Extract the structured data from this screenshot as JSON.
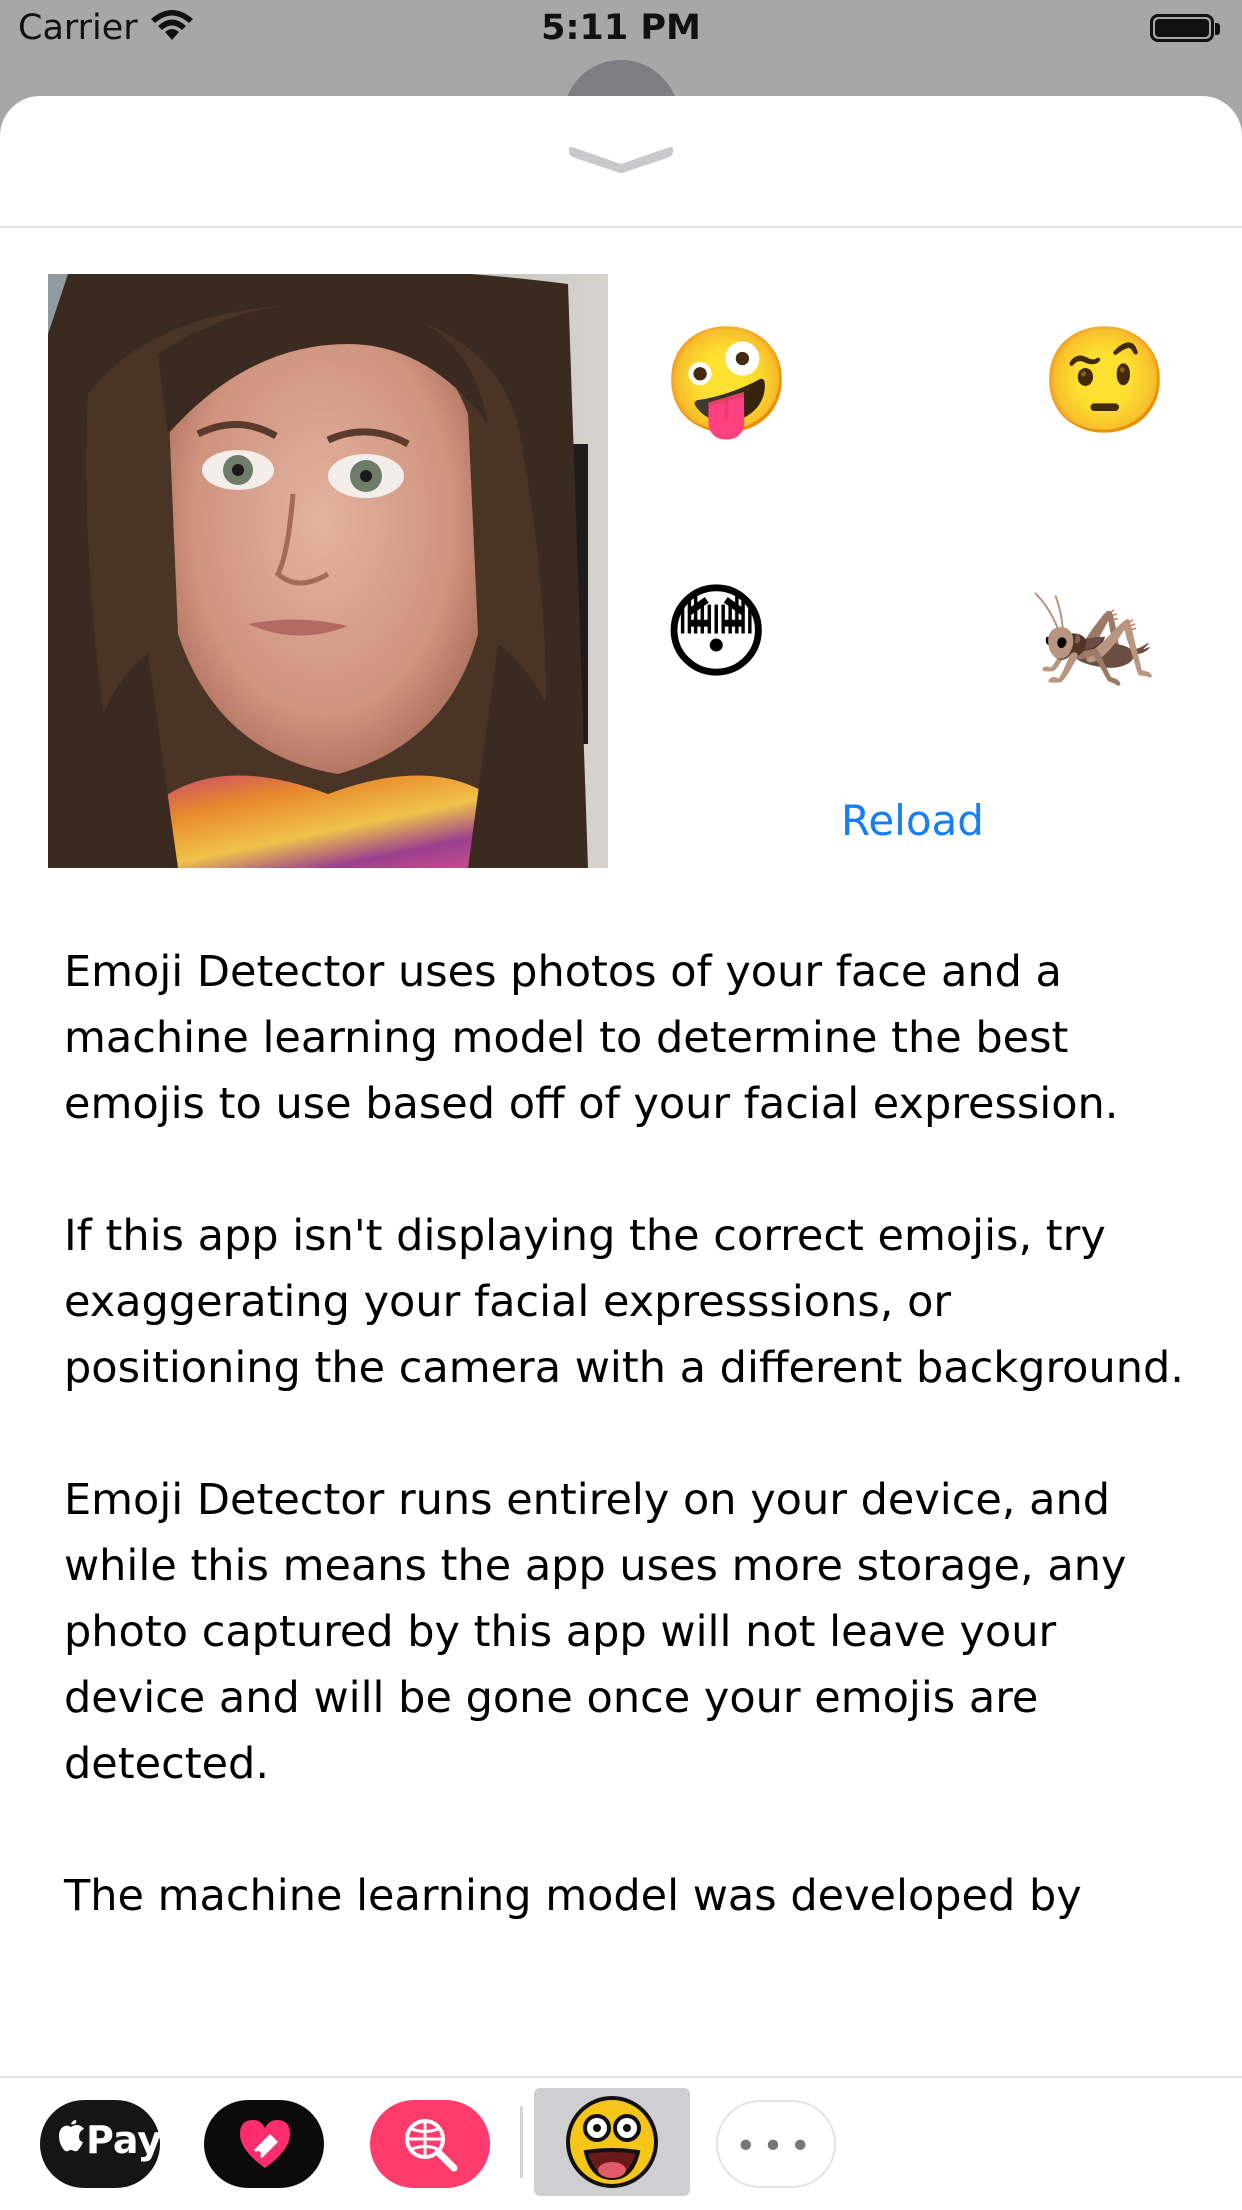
{
  "status_bar": {
    "carrier": "Carrier",
    "time": "5:11 PM"
  },
  "sheet": {
    "grabber_icon": "chevron-down-icon"
  },
  "emoji_results": {
    "items": [
      "🤪",
      "🤨",
      "😳",
      "🦗"
    ],
    "reload_label": "Reload"
  },
  "description": {
    "paragraphs": [
      "Emoji Detector uses photos of your face and a machine learning model to determine the best emojis to use based off of your facial expression.",
      "If this app isn't displaying the correct emojis, try exaggerating your facial expresssions, or positioning the camera with a different background.",
      "Emoji Detector runs entirely on your device, and while this means the app uses more storage, any photo captured by this app will not leave your device and will be gone once your emojis are detected.",
      "The machine learning model was developed by"
    ]
  },
  "app_tray": {
    "apple_pay_label": "Pay",
    "more_label": "•••",
    "icons": [
      "apple-pay-icon",
      "digital-touch-icon",
      "image-search-icon",
      "emoji-detector-icon",
      "more-icon"
    ]
  },
  "colors": {
    "accent": "#147efb",
    "backdrop": "#a7a7a7",
    "globe_app": "#ff3b6b"
  }
}
